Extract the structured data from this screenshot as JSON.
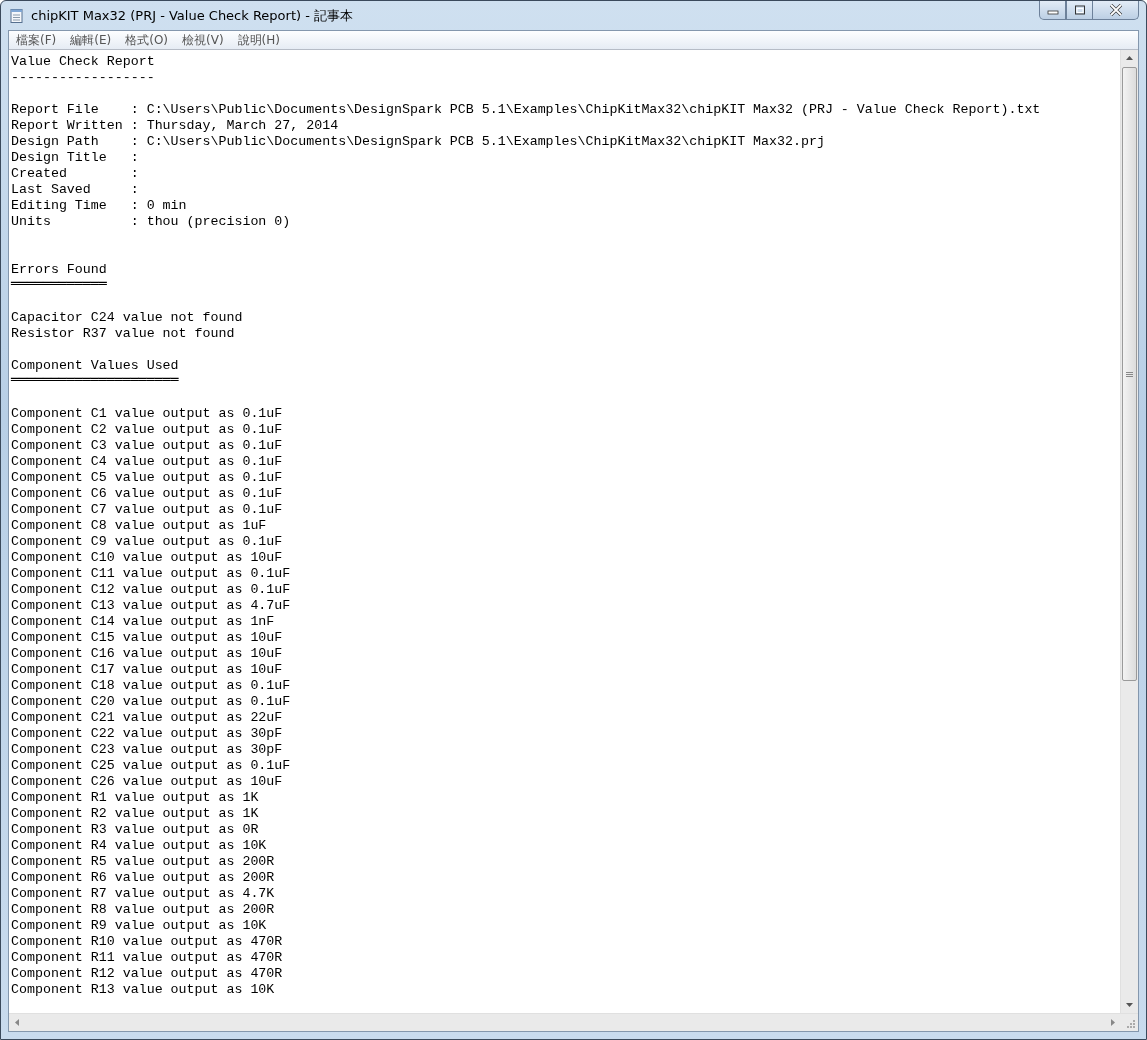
{
  "window": {
    "title": "chipKIT Max32 (PRJ - Value Check Report) - 記事本"
  },
  "menu": [
    "檔案(F)",
    "編輯(E)",
    "格式(O)",
    "檢視(V)",
    "說明(H)"
  ],
  "lines": [
    {
      "kind": "text",
      "text": "Value Check Report"
    },
    {
      "kind": "text",
      "text": "------------------"
    },
    {
      "kind": "blank"
    },
    {
      "kind": "text",
      "text": "Report File    : C:\\Users\\Public\\Documents\\DesignSpark PCB 5.1\\Examples\\ChipKitMax32\\chipKIT Max32 (PRJ - Value Check Report).txt"
    },
    {
      "kind": "text",
      "text": "Report Written : Thursday, March 27, 2014"
    },
    {
      "kind": "text",
      "text": "Design Path    : C:\\Users\\Public\\Documents\\DesignSpark PCB 5.1\\Examples\\ChipKitMax32\\chipKIT Max32.prj"
    },
    {
      "kind": "text",
      "text": "Design Title   :"
    },
    {
      "kind": "text",
      "text": "Created        :"
    },
    {
      "kind": "text",
      "text": "Last Saved     :"
    },
    {
      "kind": "text",
      "text": "Editing Time   : 0 min"
    },
    {
      "kind": "text",
      "text": "Units          : thou (precision 0)"
    },
    {
      "kind": "blank"
    },
    {
      "kind": "blank"
    },
    {
      "kind": "text",
      "text": "Errors Found"
    },
    {
      "kind": "rule",
      "text": "════════════"
    },
    {
      "kind": "blank"
    },
    {
      "kind": "text",
      "text": "Capacitor C24 value not found"
    },
    {
      "kind": "text",
      "text": "Resistor R37 value not found"
    },
    {
      "kind": "blank"
    },
    {
      "kind": "text",
      "text": "Component Values Used"
    },
    {
      "kind": "rule",
      "text": "═════════════════════"
    },
    {
      "kind": "blank"
    },
    {
      "kind": "text",
      "text": "Component C1 value output as 0.1uF"
    },
    {
      "kind": "text",
      "text": "Component C2 value output as 0.1uF"
    },
    {
      "kind": "text",
      "text": "Component C3 value output as 0.1uF"
    },
    {
      "kind": "text",
      "text": "Component C4 value output as 0.1uF"
    },
    {
      "kind": "text",
      "text": "Component C5 value output as 0.1uF"
    },
    {
      "kind": "text",
      "text": "Component C6 value output as 0.1uF"
    },
    {
      "kind": "text",
      "text": "Component C7 value output as 0.1uF"
    },
    {
      "kind": "text",
      "text": "Component C8 value output as 1uF"
    },
    {
      "kind": "text",
      "text": "Component C9 value output as 0.1uF"
    },
    {
      "kind": "text",
      "text": "Component C10 value output as 10uF"
    },
    {
      "kind": "text",
      "text": "Component C11 value output as 0.1uF"
    },
    {
      "kind": "text",
      "text": "Component C12 value output as 0.1uF"
    },
    {
      "kind": "text",
      "text": "Component C13 value output as 4.7uF"
    },
    {
      "kind": "text",
      "text": "Component C14 value output as 1nF"
    },
    {
      "kind": "text",
      "text": "Component C15 value output as 10uF"
    },
    {
      "kind": "text",
      "text": "Component C16 value output as 10uF"
    },
    {
      "kind": "text",
      "text": "Component C17 value output as 10uF"
    },
    {
      "kind": "text",
      "text": "Component C18 value output as 0.1uF"
    },
    {
      "kind": "text",
      "text": "Component C20 value output as 0.1uF"
    },
    {
      "kind": "text",
      "text": "Component C21 value output as 22uF"
    },
    {
      "kind": "text",
      "text": "Component C22 value output as 30pF"
    },
    {
      "kind": "text",
      "text": "Component C23 value output as 30pF"
    },
    {
      "kind": "text",
      "text": "Component C25 value output as 0.1uF"
    },
    {
      "kind": "text",
      "text": "Component C26 value output as 10uF"
    },
    {
      "kind": "text",
      "text": "Component R1 value output as 1K"
    },
    {
      "kind": "text",
      "text": "Component R2 value output as 1K"
    },
    {
      "kind": "text",
      "text": "Component R3 value output as 0R"
    },
    {
      "kind": "text",
      "text": "Component R4 value output as 10K"
    },
    {
      "kind": "text",
      "text": "Component R5 value output as 200R"
    },
    {
      "kind": "text",
      "text": "Component R6 value output as 200R"
    },
    {
      "kind": "text",
      "text": "Component R7 value output as 4.7K"
    },
    {
      "kind": "text",
      "text": "Component R8 value output as 200R"
    },
    {
      "kind": "text",
      "text": "Component R9 value output as 10K"
    },
    {
      "kind": "text",
      "text": "Component R10 value output as 470R"
    },
    {
      "kind": "text",
      "text": "Component R11 value output as 470R"
    },
    {
      "kind": "text",
      "text": "Component R12 value output as 470R"
    },
    {
      "kind": "text",
      "text": "Component R13 value output as 10K"
    }
  ]
}
